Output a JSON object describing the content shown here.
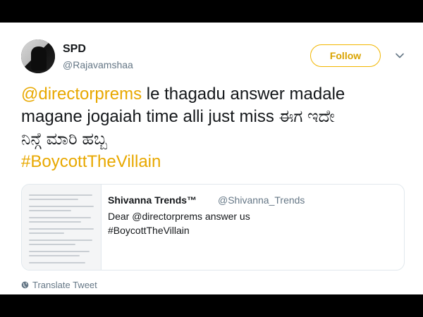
{
  "author": {
    "name": "SPD",
    "handle": "@Rajavamshaa"
  },
  "follow_label": "Follow",
  "icons": {
    "avatar": "profile-photo",
    "caret": "chevron-down-icon",
    "translate": "globe-icon"
  },
  "tweet": {
    "line1_mention": "@directorprems",
    "line1_rest": " le thagadu answer madale",
    "line2": "magane jogaiah time alli just miss ಈಗ ಇದೇ",
    "line3": "ನಿನ್ಗೆ ಮಾರಿ ಹಬ್ಬ",
    "hashtag": "#BoycottTheVillain"
  },
  "quote": {
    "name": "Shivanna Trends™",
    "handle": "@Shivanna_Trends",
    "text_line1": "Dear @directorprems answer us",
    "text_line2": "#BoycottTheVillain"
  },
  "translate_label": "Translate Tweet",
  "colors": {
    "accent": "#e8a800",
    "muted": "#657786",
    "text": "#14171a",
    "border": "#e1e8ed"
  }
}
